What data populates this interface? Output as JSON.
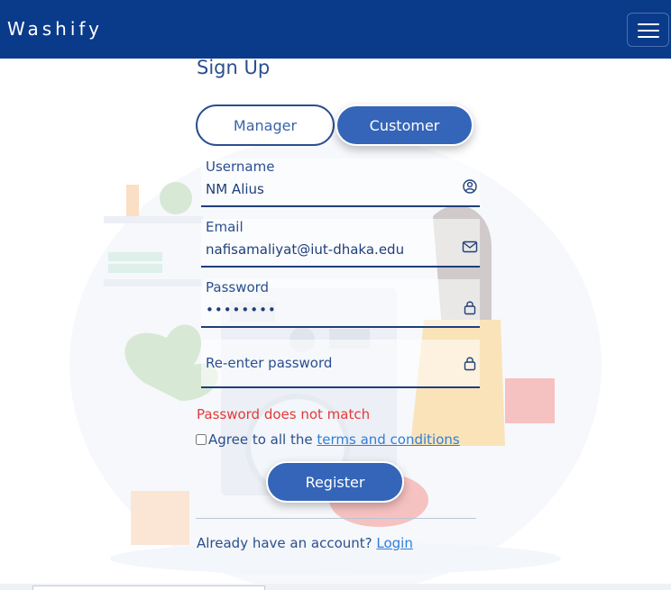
{
  "app": {
    "brand": "Washify"
  },
  "form": {
    "title": "Sign Up",
    "roles": {
      "manager": "Manager",
      "customer": "Customer",
      "selected": "Customer"
    },
    "username": {
      "label": "Username",
      "value": "NM Alius",
      "icon": "user-circle-icon"
    },
    "email": {
      "label": "Email",
      "value": "nafisamaliyat@iut-dhaka.edu",
      "icon": "envelope-icon"
    },
    "password": {
      "label": "Password",
      "value": "••••••••",
      "icon": "lock-icon"
    },
    "reenter": {
      "placeholder": "Re-enter password",
      "value": "",
      "icon": "lock-icon"
    },
    "error": "Password does not match",
    "agree": {
      "prefix": "Agree to all the ",
      "link": "terms and conditions",
      "checked": false
    },
    "register": "Register",
    "footer": {
      "prompt": "Already have an account? ",
      "link": "Login"
    }
  },
  "colors": {
    "navbar": "#0a3a8a",
    "primary": "#3465b8",
    "error": "#e23a3a",
    "link": "#2f7fd8"
  }
}
